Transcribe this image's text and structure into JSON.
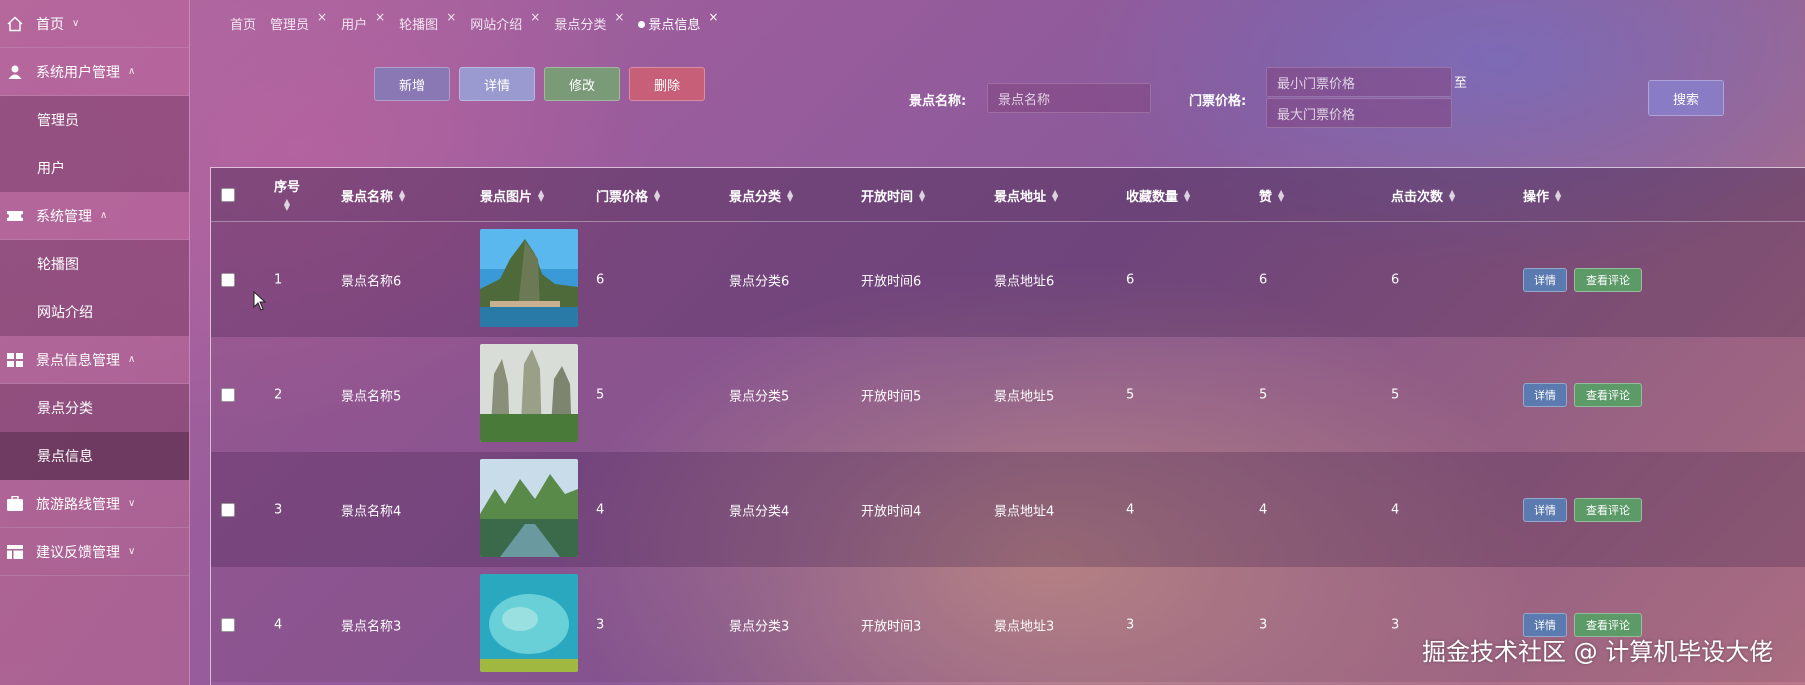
{
  "sidebar": {
    "items": [
      {
        "label": "首页",
        "icon": "home-icon",
        "chevron": "∨"
      },
      {
        "label": "系统用户管理",
        "icon": "user-icon",
        "chevron": "∧",
        "children": [
          "管理员",
          "用户"
        ]
      },
      {
        "label": "系统管理",
        "icon": "ticket-icon",
        "chevron": "∧",
        "children": [
          "轮播图",
          "网站介绍"
        ]
      },
      {
        "label": "景点信息管理",
        "icon": "grid-icon",
        "chevron": "∧",
        "children": [
          "景点分类",
          "景点信息"
        ]
      },
      {
        "label": "旅游路线管理",
        "icon": "briefcase-icon",
        "chevron": "∨"
      },
      {
        "label": "建议反馈管理",
        "icon": "layout-icon",
        "chevron": "∨"
      }
    ],
    "active_child": "景点信息"
  },
  "tabs": [
    {
      "label": "首页",
      "closable": false
    },
    {
      "label": "管理员",
      "closable": true
    },
    {
      "label": "用户",
      "closable": true
    },
    {
      "label": "轮播图",
      "closable": true
    },
    {
      "label": "网站介绍",
      "closable": true
    },
    {
      "label": "景点分类",
      "closable": true
    },
    {
      "label": "景点信息",
      "closable": true,
      "active": true
    }
  ],
  "toolbar": {
    "add": "新增",
    "detail": "详情",
    "edit": "修改",
    "delete": "删除",
    "name_label": "景点名称:",
    "name_placeholder": "景点名称",
    "price_label": "门票价格:",
    "min_price_placeholder": "最小门票价格",
    "max_price_placeholder": "最大门票价格",
    "range_sep": "至",
    "search": "搜索"
  },
  "table": {
    "headers": [
      "序号",
      "景点名称",
      "景点图片",
      "门票价格",
      "景点分类",
      "开放时间",
      "景点地址",
      "收藏数量",
      "赞",
      "点击次数",
      "操作"
    ],
    "rows": [
      {
        "no": "1",
        "name": "景点名称6",
        "price": "6",
        "category": "景点分类6",
        "open_time": "开放时间6",
        "address": "景点地址6",
        "favorites": "6",
        "likes": "6",
        "clicks": "6",
        "image": "mountain-lake-photo"
      },
      {
        "no": "2",
        "name": "景点名称5",
        "price": "5",
        "category": "景点分类5",
        "open_time": "开放时间5",
        "address": "景点地址5",
        "favorites": "5",
        "likes": "5",
        "clicks": "5",
        "image": "misty-peaks-photo"
      },
      {
        "no": "3",
        "name": "景点名称4",
        "price": "4",
        "category": "景点分类4",
        "open_time": "开放时间4",
        "address": "景点地址4",
        "favorites": "4",
        "likes": "4",
        "clicks": "4",
        "image": "river-karst-photo"
      },
      {
        "no": "4",
        "name": "景点名称3",
        "price": "3",
        "category": "景点分类3",
        "open_time": "开放时间3",
        "address": "景点地址3",
        "favorites": "3",
        "likes": "3",
        "clicks": "3",
        "image": "blue-lake-photo"
      }
    ],
    "action_detail": "详情",
    "action_comments": "查看评论"
  },
  "watermark": "掘金技术社区 @ 计算机毕设大佬",
  "colors": {
    "accent": "#8a78b4",
    "delete": "#c85f78",
    "edit": "#7a9a78",
    "comment": "#5c9a68"
  }
}
